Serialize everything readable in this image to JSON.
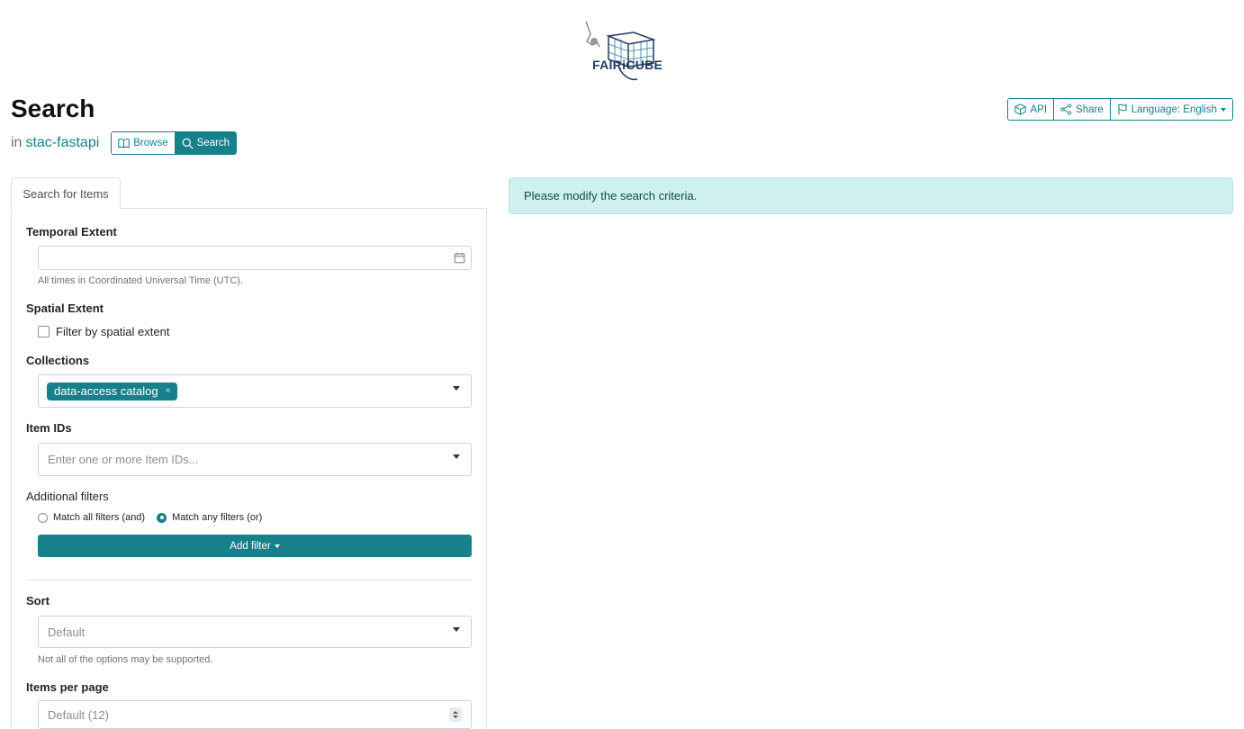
{
  "logo": {
    "text": "FAIRiCUBE"
  },
  "header": {
    "title": "Search",
    "in_label": "in",
    "catalog_link": "stac-fastapi",
    "view_buttons": {
      "browse": "Browse",
      "search": "Search"
    }
  },
  "top_actions": {
    "api": "API",
    "share": "Share",
    "language": "Language: English"
  },
  "tabs": [
    {
      "label": "Search for Items"
    }
  ],
  "form": {
    "temporal_extent": {
      "label": "Temporal Extent",
      "value": "",
      "help": "All times in Coordinated Universal Time (UTC)."
    },
    "spatial_extent": {
      "label": "Spatial Extent",
      "checkbox_label": "Filter by spatial extent",
      "checked": false
    },
    "collections": {
      "label": "Collections",
      "selected": [
        "data-access catalog"
      ],
      "remove_glyph": "×"
    },
    "item_ids": {
      "label": "Item IDs",
      "placeholder": "Enter one or more Item IDs..."
    },
    "additional_filters": {
      "label": "Additional filters",
      "options": [
        {
          "label": "Match all filters (and)",
          "checked": false
        },
        {
          "label": "Match any filters (or)",
          "checked": true
        }
      ],
      "add_button": "Add filter"
    },
    "sort": {
      "label": "Sort",
      "placeholder": "Default",
      "help": "Not all of the options may be supported."
    },
    "items_per_page": {
      "label": "Items per page",
      "placeholder": "Default (12)"
    }
  },
  "alert": {
    "text": "Please modify the search criteria."
  },
  "colors": {
    "accent": "#16808b",
    "alert_bg": "#cff0ef"
  }
}
